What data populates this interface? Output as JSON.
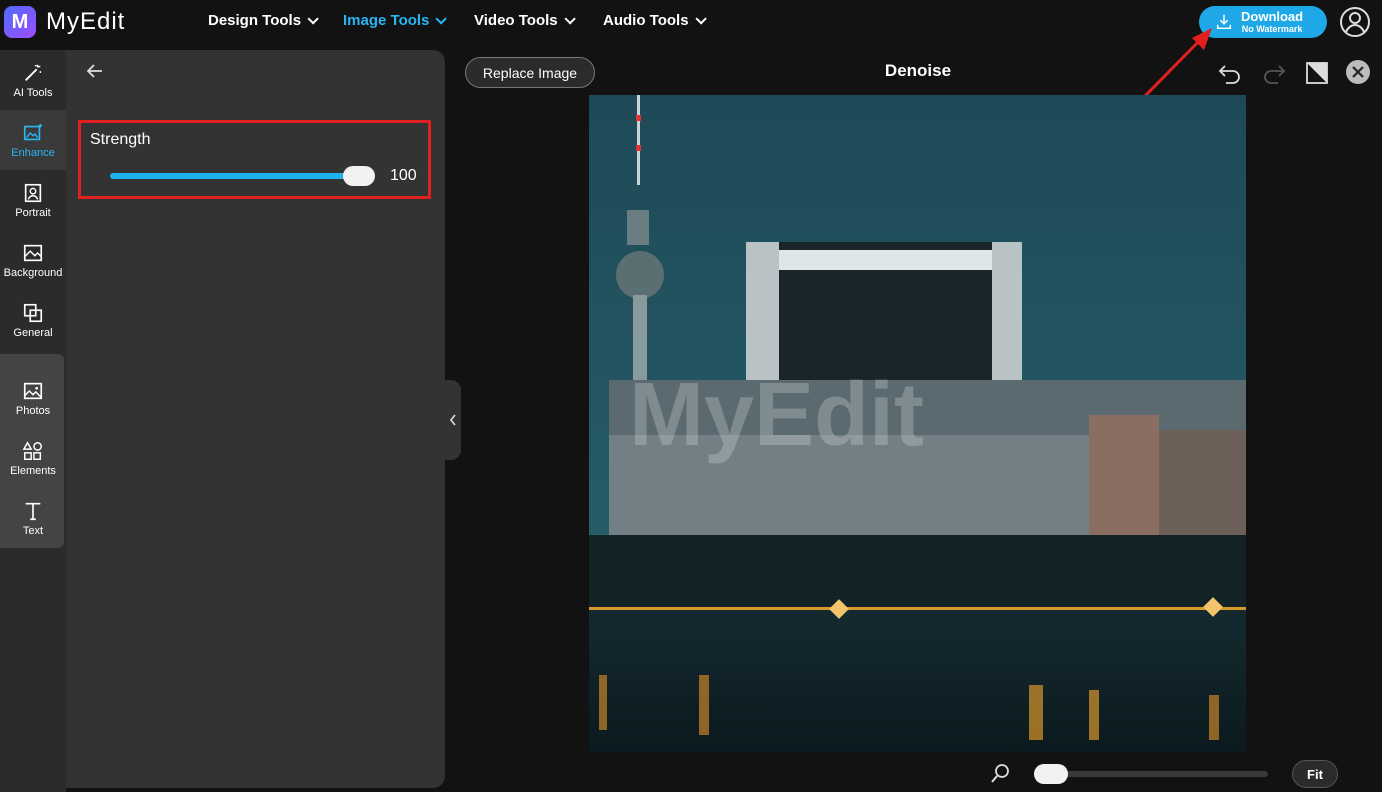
{
  "app": {
    "name": "MyEdit",
    "logo_letter": "M"
  },
  "nav": {
    "items": [
      {
        "label": "Design Tools",
        "active": false
      },
      {
        "label": "Image Tools",
        "active": true
      },
      {
        "label": "Video Tools",
        "active": false
      },
      {
        "label": "Audio Tools",
        "active": false
      }
    ]
  },
  "header": {
    "download_label": "Download",
    "download_sub": "No Watermark"
  },
  "rail": {
    "items": [
      {
        "label": "AI Tools",
        "icon": "magic-wand-icon"
      },
      {
        "label": "Enhance",
        "icon": "enhance-image-icon",
        "active": true
      },
      {
        "label": "Portrait",
        "icon": "portrait-icon"
      },
      {
        "label": "Background",
        "icon": "background-icon"
      },
      {
        "label": "General",
        "icon": "layers-icon"
      },
      {
        "label": "Photos",
        "icon": "photo-icon"
      },
      {
        "label": "Elements",
        "icon": "shapes-icon"
      },
      {
        "label": "Text",
        "icon": "text-icon"
      }
    ]
  },
  "panel": {
    "strength_label": "Strength",
    "strength_value": "100",
    "strength_fraction": 1.0
  },
  "editor": {
    "replace_label": "Replace Image",
    "title": "Denoise",
    "fit_label": "Fit",
    "watermark": "MyEdit",
    "zoom_fraction": 0.0
  },
  "colors": {
    "accent": "#29b6f6",
    "download": "#1fa8e8",
    "highlight": "#e02020"
  }
}
